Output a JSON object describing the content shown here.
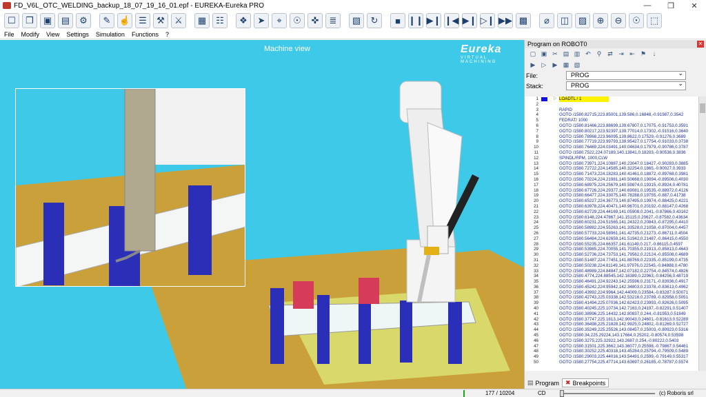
{
  "window": {
    "title": "FD_V6L_OTC_WELDING_backup_18_07_19_16_01.epf - EUREKA-Eureka PRO",
    "minimize": "—",
    "maximize": "❐",
    "close": "✕"
  },
  "menu": [
    "File",
    "Modify",
    "View",
    "Settings",
    "Simulation",
    "Functions",
    "?"
  ],
  "toolbar_icons": [
    "new-file-icon",
    "open-file-icon",
    "save-icon",
    "save-as-icon",
    "robot-icon",
    "edit-icon",
    "pick-icon",
    "clipboard-icon",
    "settings-icon",
    "tools-icon",
    "window-icon",
    "options-icon",
    "parts-icon",
    "pointer-icon",
    "target-icon",
    "calibrate-icon",
    "joystick-icon",
    "script-icon",
    "cell-icon",
    "reset-icon",
    "stop-icon",
    "pause-icon",
    "step-icon",
    "step-back-icon",
    "step-into-icon",
    "step-over-icon",
    "run-to-icon",
    "camera-icon",
    "measure-icon",
    "media-icon",
    "film-icon",
    "zoom-in-icon",
    "zoom-out-icon",
    "zoom-fit-icon",
    "zoom-area-icon"
  ],
  "toolbar_glyphs": [
    "☐",
    "❐",
    "▣",
    "▤",
    "⚙",
    "✎",
    "☝",
    "☰",
    "⚒",
    "⚔",
    "▦",
    "☷",
    "❖",
    "➤",
    "⌖",
    "☉",
    "✜",
    "≣",
    "▧",
    "↻",
    "■",
    "❙❙",
    "▶❙",
    "❙◀",
    "▶❙",
    "▷❙",
    "▶▶",
    "▩",
    "⌀",
    "◫",
    "▨",
    "⊕",
    "⊖",
    "☉",
    "⬚"
  ],
  "viewport": {
    "title": "Machine view",
    "logo_text": "Eureka",
    "logo_sub": "VIRTUAL MACHINING"
  },
  "panel": {
    "title": "Program on ROBOT0",
    "close": "✕",
    "file_label": "File:",
    "file_value": "PROG",
    "stack_label": "Stack:",
    "stack_value": "PROG",
    "lines": [
      "LOADTL / 1",
      "",
      "RAPID",
      "GOTO /1580.82715,223.85001,139.586,0.16848,-0.91987,0.3542",
      "FEDRAT/ 1000",
      "GOTO /1580.81466,223.88699,139.67807,0.17075,-0.91753,0.3591",
      "GOTO /1580.80217,223.92397,139.77014,0.17302,-0.91516,0.3640",
      "GOTO /1580.78968,223.96095,139.8622,0.17529,-0.91276,0.3689",
      "GOTO /1580.77719,223.99793,139.95427,0.17754,-0.91033,0.3738",
      "GOTO /1580.76469,224.03491,140.04634,0.17979,-0.90786,0.3787",
      "GOTO /1580.7522,224.07189,140.13841,0.18203,-0.90536,0.3836",
      "SPINDL/RPM, 1000,CLW",
      "GOTO /1580.73971,224.10887,140.23047,0.18427,-0.90283,0.3885",
      "GOTO /1580.72722,224.14585,140.32254,0.1865,-0.90027,0.3933",
      "GOTO /1580.71473,224.18283,140.41461,0.18872,-0.89768,0.3981",
      "GOTO /1580.70224,224.21981,140.50668,0.19094,-0.89506,0.4030",
      "GOTO /1580.68975,224.25679,140.59874,0.19315,-0.8924,0.40781",
      "GOTO /1580.67726,224.29377,140.69081,0.19535,-0.88972,0.4126",
      "GOTO /1580.66477,224.33075,140.78288,0.19755,-0.887,0.41738",
      "GOTO /1580.65227,224.36773,140.87495,0.19974,-0.88425,0.4221",
      "GOTO /1580.63978,224.40471,140.96701,0.20192,-0.88147,0.4268",
      "GOTO /1580.62729,224.44169,141.05908,0.2041,-0.87866,0.43162",
      "GOTO /1580.6148,224.47867,141.15115,0.20627,-0.87582,0.43634",
      "GOTO /1580.60231,224.51565,141.24322,0.20843,-0.87295,0.4410",
      "GOTO /1580.58982,224.55263,141.33528,0.21058,-0.87004,0.4457",
      "GOTO /1580.57733,224.58961,141.42735,0.21273,-0.86711,0.4504",
      "GOTO /1580.56484,224.62659,141.51942,0.21487,-0.86415,0.4550",
      "GOTO /1580.55235,224.66357,141.61149,0.217,-0.86115,0.4597",
      "GOTO /1580.53985,224.70055,141.70355,0.21913,-0.85813,0.4643",
      "GOTO /1580.52736,224.73753,141.79562,0.22124,-0.85508,0.4689",
      "GOTO /1580.51487,224.77451,141.88769,0.22335,-0.85199,0.4735",
      "GOTO /1580.50238,224.81149,141.97976,0.22545,-0.84888,0.4780",
      "GOTO /1580.48989,224.84847,142.07182,0.22754,-0.84574,0.4826",
      "GOTO /1580.4774,224.88545,142.16389,0.22963,-0.84256,0.48719",
      "GOTO /1580.46491,224.92243,142.25596,0.23171,-0.83936,0.4917",
      "GOTO /1580.45242,224.95942,142.34803,0.23378,-0.83613,0.4962",
      "GOTO /1580.43992,224.9964,142.44009,0.23584,-0.83287,0.50071",
      "GOTO /1580.42743,225.03338,142.53216,0.23789,-0.82958,0.5051",
      "GOTO /1580.41494,225.07036,142.62423,0.23993,-0.82626,0.5095",
      "GOTO /1580.40245,225.10734,142.7163,0.24197,-0.82291,0.51407",
      "GOTO /1580.38996,225.14432,142.80837,0.244,-0.81953,0.51849",
      "GOTO /1580.37747,225.1813,142.90043,0.24601,-0.81613,0.52289",
      "GOTO /1580.36498,225.21828,142.9925,0.24802,-0.81269,0.52727",
      "GOTO /1580.35249,225.25526,143.08457,0.25003,-0.80923,0.5316",
      "GOTO /1580.34,225.29224,143.17664,0.25202,-0.80574,0.53598",
      "GOTO /1580.3275,225.32922,143.2687,0.254,-0.80222,0.5403",
      "GOTO /1580.31501,225.3662,143.36077,0.25598,-0.79867,0.54461",
      "GOTO /1580.30252,225.40318,143.45284,0.25794,-0.79509,0.5489",
      "GOTO /1580.29003,225.44016,143.54491,0.2599,-0.79149,0.55317",
      "GOTO /1580.27754,225.47714,143.63697,0.26185,-0.78787,0.5574"
    ],
    "tabs": [
      {
        "label": "Program"
      },
      {
        "label": "Breakpoints"
      }
    ]
  },
  "status": {
    "counter": "177 / 10204",
    "mode": "CD",
    "copyright": "(c) Roboris srl"
  },
  "colors": {
    "sky": "#3fc9e8",
    "floor": "#c9a03a",
    "parts": "#2b2fb8",
    "robot": "#f4f4f4",
    "highlight": "#fff200"
  }
}
